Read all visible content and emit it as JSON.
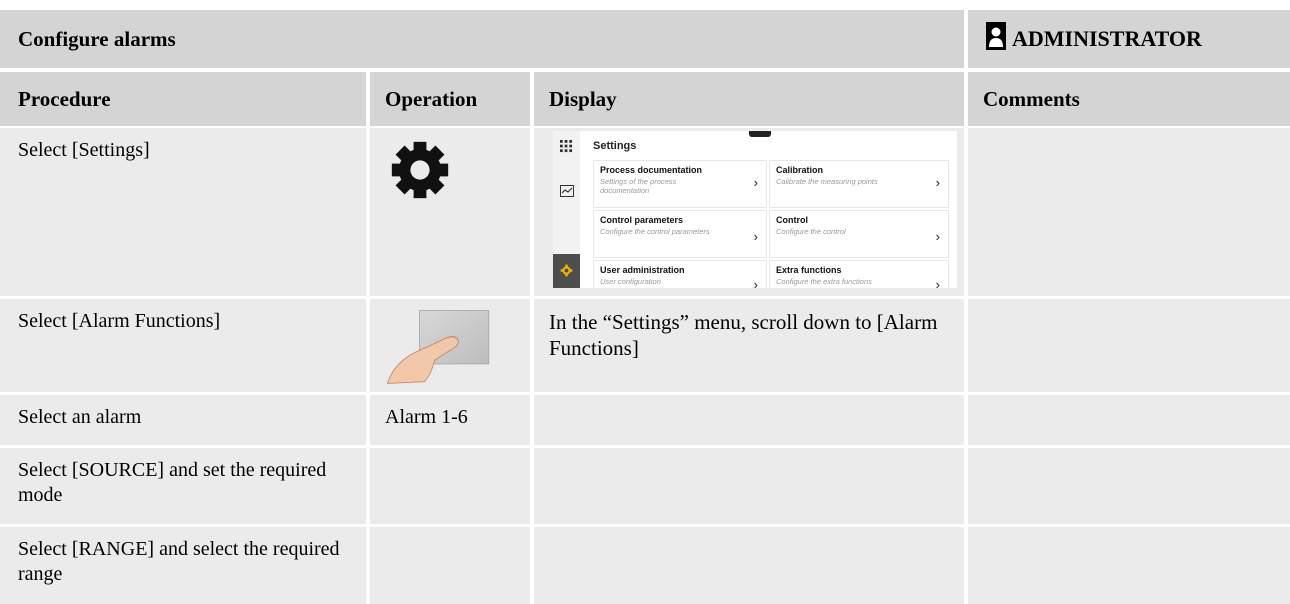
{
  "header": {
    "title": "Configure alarms",
    "role": "ADMINISTRATOR"
  },
  "columns": [
    "Procedure",
    "Operation",
    "Display",
    "Comments"
  ],
  "rows": [
    {
      "procedure": "Select [Settings]",
      "operation_icon": "gear-icon",
      "display": "",
      "comments": ""
    },
    {
      "procedure": "Select [Alarm Functions]",
      "operation_icon": "finger-touch-icon",
      "display": "In the “Settings” menu, scroll down to [Alarm Functions]",
      "comments": ""
    },
    {
      "procedure": "Select an alarm",
      "operation": "Alarm 1-6",
      "display": "",
      "comments": ""
    },
    {
      "procedure": "Select [SOURCE] and set the required mode",
      "operation": "",
      "display": "",
      "comments": ""
    },
    {
      "procedure": "Select [RANGE] and select the required range",
      "operation": "",
      "display": "",
      "comments": ""
    }
  ],
  "settings_screen": {
    "title": "Settings",
    "cards": [
      {
        "title": "Process documentation",
        "subtitle": "Settings of the process documentation"
      },
      {
        "title": "Calibration",
        "subtitle": "Calibrate the measuring points"
      },
      {
        "title": "Control parameters",
        "subtitle": "Configure the control parameters"
      },
      {
        "title": "Control",
        "subtitle": "Configure the control"
      },
      {
        "title": "User administration",
        "subtitle": "User configuration"
      },
      {
        "title": "Extra functions",
        "subtitle": "Configure the extra functions"
      }
    ],
    "rail_icons": [
      "grid-icon",
      "chart-icon",
      "gear-icon"
    ],
    "accent_color": "#f0b400"
  }
}
